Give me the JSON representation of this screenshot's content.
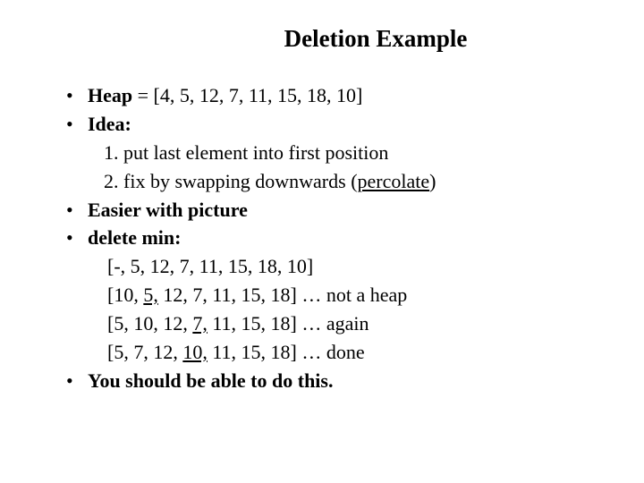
{
  "title": "Deletion Example",
  "items": {
    "heap_label": "Heap",
    "heap_rest": "  = [4, 5, 12, 7, 11, 15, 18, 10]",
    "idea_label": "Idea:",
    "idea_step1": "1. put last element into first position",
    "idea_step2_pre": "2. fix by swapping downwards (",
    "idea_step2_u": "percolate",
    "idea_step2_post": ")",
    "easier": "Easier with picture",
    "delete_min": "delete min:",
    "dm_line1": "[-, 5, 12, 7, 11, 15, 18, 10]",
    "dm_line2_a": "[10, ",
    "dm_line2_u": "5,",
    "dm_line2_b": " 12, 7, 11, 15, 18]  … not a heap",
    "dm_line3_a": "[5, 10, 12, ",
    "dm_line3_u": "7,",
    "dm_line3_b": " 11, 15, 18]  … again",
    "dm_line4_a": "[5, 7, 12, ",
    "dm_line4_u": "10,",
    "dm_line4_b": " 11, 15, 18]  … done",
    "closing": "You should be able to do this."
  }
}
